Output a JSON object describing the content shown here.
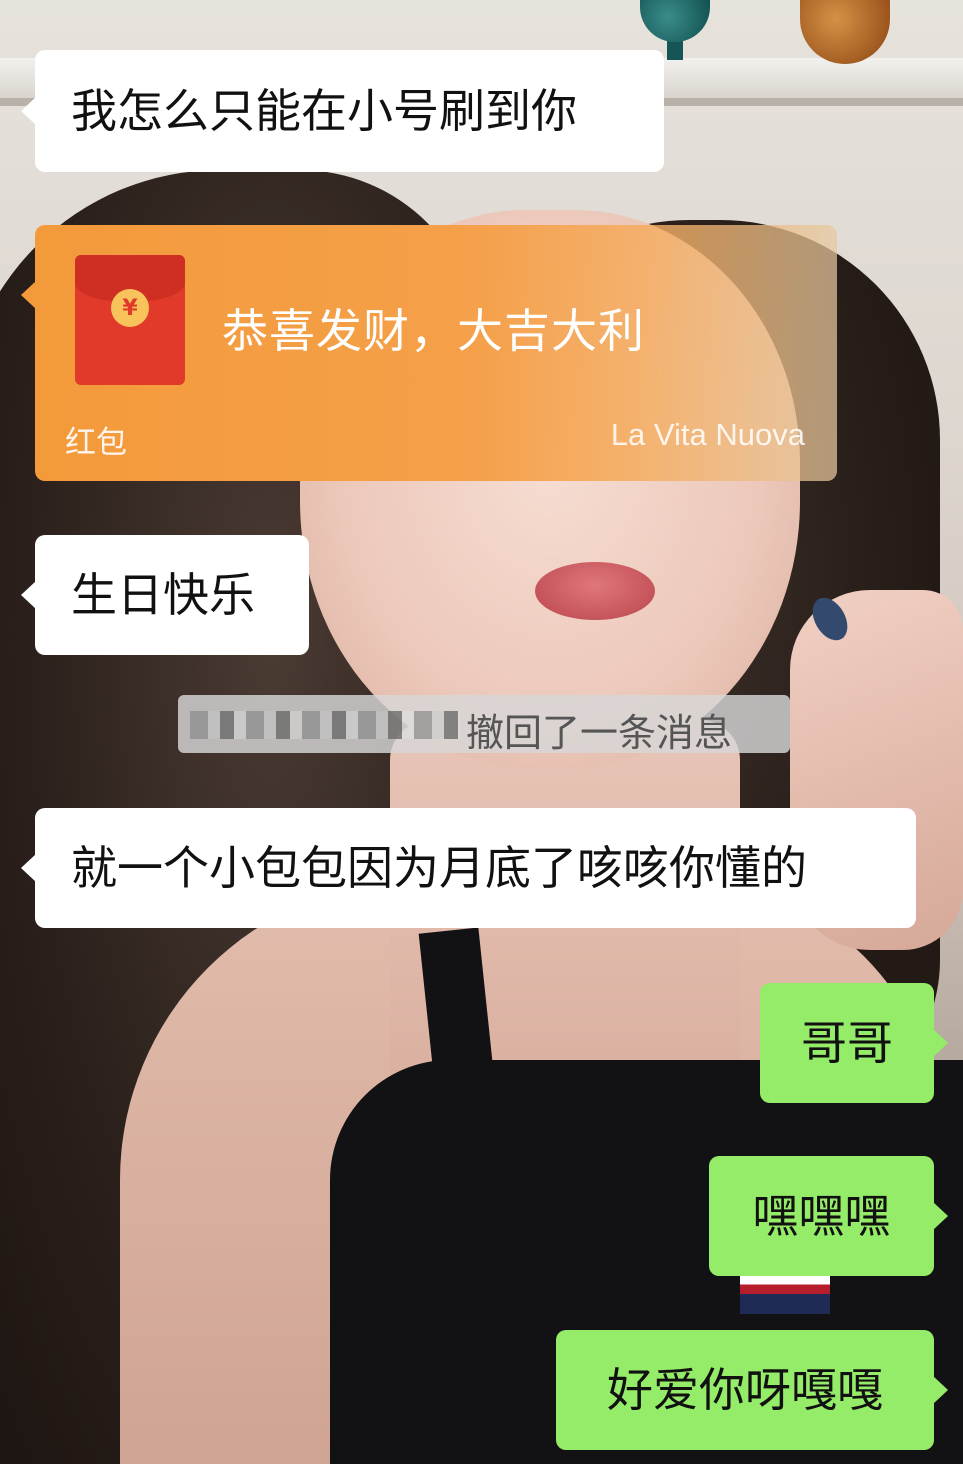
{
  "messages": {
    "m1": "我怎么只能在小号刷到你",
    "m3": "生日快乐",
    "m4": "就一个小包包因为月底了咳咳你懂的",
    "m5": "哥哥",
    "m6": "嘿嘿嘿",
    "m7": "好爱你呀嘎嘎"
  },
  "red_packet": {
    "greeting": "恭喜发财，大吉大利",
    "type_label": "红包",
    "brand": "La Vita Nuova",
    "coin_symbol": "¥",
    "color": "#f39a3a"
  },
  "recall_notice": {
    "text": "撤回了一条消息"
  },
  "colors": {
    "incoming_bubble": "#ffffff",
    "outgoing_bubble": "#95ec69"
  }
}
